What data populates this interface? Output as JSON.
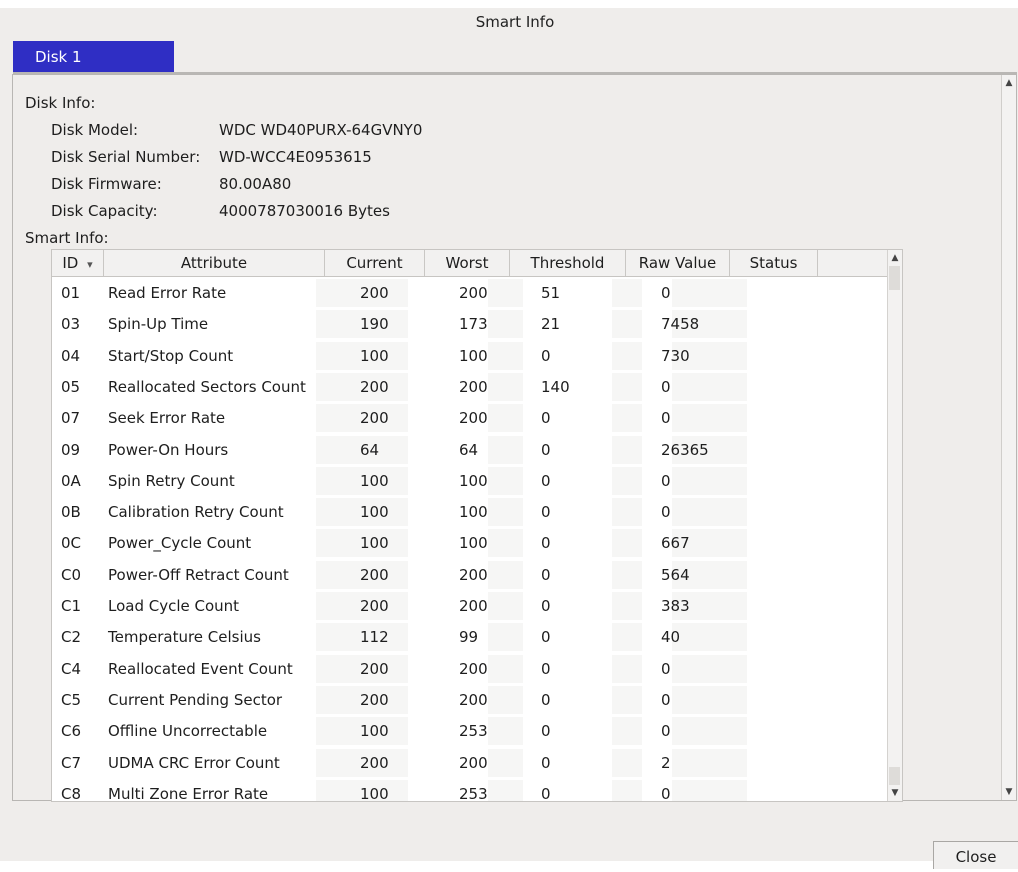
{
  "window": {
    "title": "Smart Info"
  },
  "tabs": [
    {
      "label": "Disk 1",
      "active": true
    }
  ],
  "disk_info": {
    "label": "Disk Info:",
    "fields": [
      {
        "key": "Disk Model:",
        "value": "WDC WD40PURX-64GVNY0"
      },
      {
        "key": "Disk Serial Number:",
        "value": "WD-WCC4E0953615"
      },
      {
        "key": "Disk Firmware:",
        "value": "80.00A80"
      },
      {
        "key": "Disk Capacity:",
        "value": "4000787030016 Bytes"
      }
    ]
  },
  "smart_info": {
    "label": "Smart Info:",
    "columns": [
      "ID",
      "Attribute",
      "Current",
      "Worst",
      "Threshold",
      "Raw Value",
      "Status"
    ],
    "sort_indicator": "▾",
    "rows": [
      {
        "id": "01",
        "attribute": "Read Error Rate",
        "current": "200",
        "worst": "200",
        "threshold": "51",
        "raw": "0",
        "status": ""
      },
      {
        "id": "03",
        "attribute": "Spin-Up Time",
        "current": "190",
        "worst": "173",
        "threshold": "21",
        "raw": "7458",
        "status": ""
      },
      {
        "id": "04",
        "attribute": "Start/Stop Count",
        "current": "100",
        "worst": "100",
        "threshold": "0",
        "raw": "730",
        "status": ""
      },
      {
        "id": "05",
        "attribute": "Reallocated Sectors Count",
        "current": "200",
        "worst": "200",
        "threshold": "140",
        "raw": "0",
        "status": ""
      },
      {
        "id": "07",
        "attribute": "Seek Error Rate",
        "current": "200",
        "worst": "200",
        "threshold": "0",
        "raw": "0",
        "status": ""
      },
      {
        "id": "09",
        "attribute": "Power-On Hours",
        "current": "64",
        "worst": "64",
        "threshold": "0",
        "raw": "26365",
        "status": ""
      },
      {
        "id": "0A",
        "attribute": "Spin Retry Count",
        "current": "100",
        "worst": "100",
        "threshold": "0",
        "raw": "0",
        "status": ""
      },
      {
        "id": "0B",
        "attribute": "Calibration Retry Count",
        "current": "100",
        "worst": "100",
        "threshold": "0",
        "raw": "0",
        "status": ""
      },
      {
        "id": "0C",
        "attribute": "Power_Cycle Count",
        "current": "100",
        "worst": "100",
        "threshold": "0",
        "raw": "667",
        "status": ""
      },
      {
        "id": "C0",
        "attribute": "Power-Off Retract Count",
        "current": "200",
        "worst": "200",
        "threshold": "0",
        "raw": "564",
        "status": ""
      },
      {
        "id": "C1",
        "attribute": "Load Cycle Count",
        "current": "200",
        "worst": "200",
        "threshold": "0",
        "raw": "383",
        "status": ""
      },
      {
        "id": "C2",
        "attribute": "Temperature Celsius",
        "current": "112",
        "worst": "99",
        "threshold": "0",
        "raw": "40",
        "status": ""
      },
      {
        "id": "C4",
        "attribute": "Reallocated Event Count",
        "current": "200",
        "worst": "200",
        "threshold": "0",
        "raw": "0",
        "status": ""
      },
      {
        "id": "C5",
        "attribute": "Current Pending Sector",
        "current": "200",
        "worst": "200",
        "threshold": "0",
        "raw": "0",
        "status": ""
      },
      {
        "id": "C6",
        "attribute": "Offline Uncorrectable",
        "current": "100",
        "worst": "253",
        "threshold": "0",
        "raw": "0",
        "status": ""
      },
      {
        "id": "C7",
        "attribute": "UDMA CRC Error Count",
        "current": "200",
        "worst": "200",
        "threshold": "0",
        "raw": "2",
        "status": ""
      },
      {
        "id": "C8",
        "attribute": "Multi Zone Error Rate",
        "current": "100",
        "worst": "253",
        "threshold": "0",
        "raw": "0",
        "status": ""
      }
    ]
  },
  "buttons": {
    "close": "Close"
  },
  "icons": {
    "scroll_up": "scroll-up-arrow",
    "scroll_down": "scroll-down-arrow",
    "sort": "sort-descending-arrow"
  }
}
